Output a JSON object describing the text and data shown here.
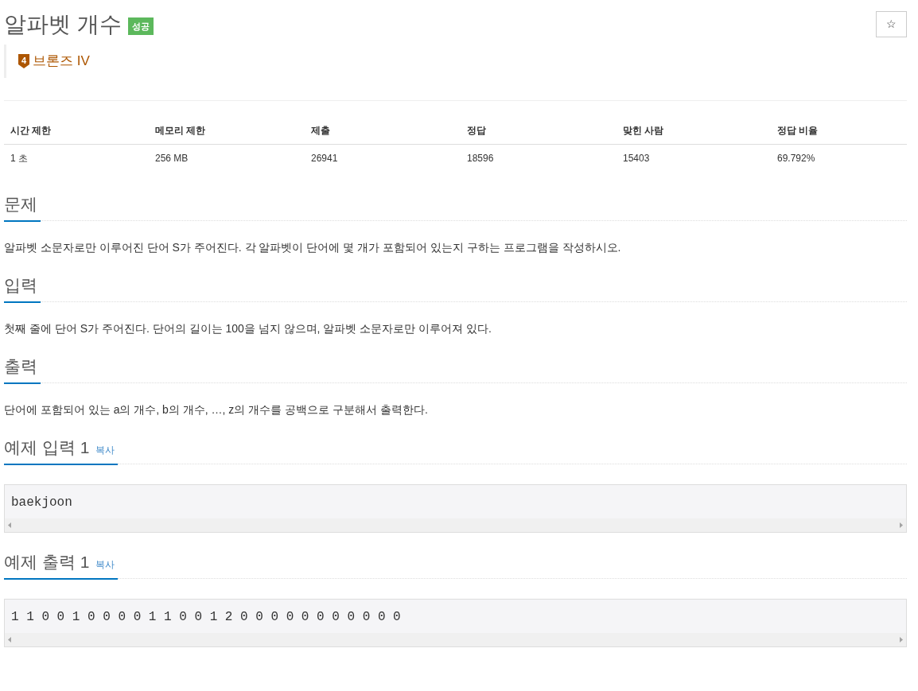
{
  "title": "알파벳 개수",
  "result_badge": "성공",
  "tier": {
    "number": "4",
    "label": "브론즈 IV"
  },
  "star_button": "☆",
  "info_table": {
    "columns": [
      "시간 제한",
      "메모리 제한",
      "제출",
      "정답",
      "맞힌 사람",
      "정답 비율"
    ],
    "row": [
      "1 초",
      "256 MB",
      "26941",
      "18596",
      "15403",
      "69.792%"
    ]
  },
  "sections": [
    {
      "title": "문제",
      "body": "알파벳 소문자로만 이루어진 단어 S가 주어진다. 각 알파벳이 단어에 몇 개가 포함되어 있는지 구하는 프로그램을 작성하시오."
    },
    {
      "title": "입력",
      "body": "첫째 줄에 단어 S가 주어진다. 단어의 길이는 100을 넘지 않으며, 알파벳 소문자로만 이루어져 있다."
    },
    {
      "title": "출력",
      "body": "단어에 포함되어 있는 a의 개수, b의 개수, …, z의 개수를 공백으로 구분해서 출력한다."
    }
  ],
  "samples": [
    {
      "title": "예제 입력 1",
      "copy": "복사",
      "content": "baekjoon"
    },
    {
      "title": "예제 출력 1",
      "copy": "복사",
      "content": "1 1 0 0 1 0 0 0 0 1 1 0 0 1 2 0 0 0 0 0 0 0 0 0 0 0"
    }
  ]
}
